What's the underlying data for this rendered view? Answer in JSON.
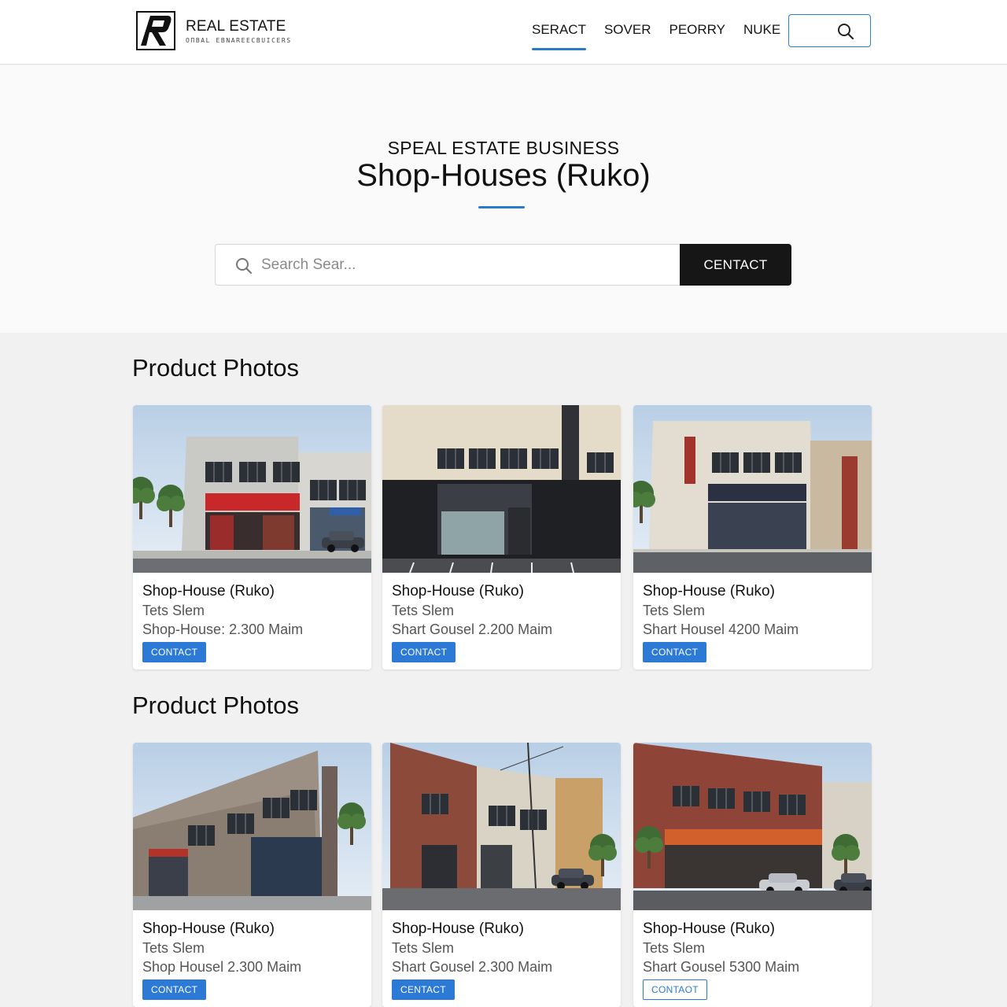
{
  "header": {
    "brand_name": "REAL ESTATE",
    "brand_tagline": "OΠBAL EBNAREECBUICERS",
    "nav": [
      {
        "label": "SERACT",
        "active": true
      },
      {
        "label": "SOVER",
        "active": false
      },
      {
        "label": "PEORRY",
        "active": false
      },
      {
        "label": "NUKE",
        "active": false
      }
    ],
    "accent_color": "#2a7bc4"
  },
  "hero": {
    "subtitle": "SPEAL ESTATE BUSINESS",
    "title": "Shop-Houses (Ruko)",
    "search_placeholder": "Search Sear...",
    "search_button": "CENTACT"
  },
  "sections": [
    {
      "title": "Product Photos",
      "cards": [
        {
          "title": "Shop-House (Ruko)",
          "subtitle": "Tets Slem",
          "price": "Shop-House: 2.300 Maim",
          "button": "CONTACT",
          "button_style": "filled"
        },
        {
          "title": "Shop-House (Ruko)",
          "subtitle": "Tets Slem",
          "price": "Shart Gousel 2.200 Maim",
          "button": "CONTACT",
          "button_style": "filled"
        },
        {
          "title": "Shop-House (Ruko)",
          "subtitle": "Tets Slem",
          "price": "Shart Housel 4200 Maim",
          "button": "CONTACT",
          "button_style": "filled"
        }
      ]
    },
    {
      "title": "Product Photos",
      "cards": [
        {
          "title": "Shop-House (Ruko)",
          "subtitle": "Tets Slem",
          "price": "Shop Housel 2.300 Maim",
          "button": "CONTACT",
          "button_style": "filled"
        },
        {
          "title": "Shop-House (Ruko)",
          "subtitle": "Tets Slem",
          "price": "Shart Gousel 2.300 Maim",
          "button": "CENTACT",
          "button_style": "filled"
        },
        {
          "title": "Shop-House (Ruko)",
          "subtitle": "Tets Slem",
          "price": "Shart Gousel 5300 Maim",
          "button": "CONTAOT",
          "button_style": "outline"
        }
      ]
    }
  ]
}
